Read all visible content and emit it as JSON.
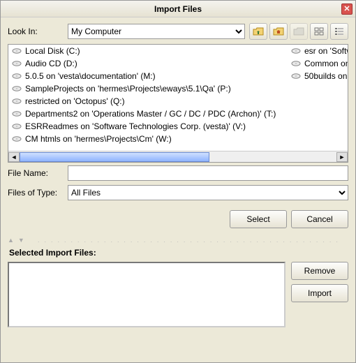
{
  "title": "Import Files",
  "lookin_label": "Look In:",
  "lookin_value": "My Computer",
  "files_col1": [
    "Local Disk (C:)",
    "Audio CD (D:)",
    "5.0.5 on 'vesta\\documentation' (M:)",
    "SampleProjects on 'hermes\\Projects\\eways\\5.1\\Qa' (P:)",
    "restricted on 'Octopus' (Q:)",
    "Departments2 on 'Operations Master / GC / DC / PDC (Archon)' (T:)",
    "ESRReadmes on 'Software Technologies Corp. (vesta)' (V:)",
    "CM htmls on 'hermes\\Projects\\Cm' (W:)"
  ],
  "files_col2": [
    "esr on 'Softw",
    "Common on",
    "50builds on"
  ],
  "filename_label": "File Name:",
  "filename_value": "",
  "filetype_label": "Files of Type:",
  "filetype_value": "All Files",
  "btn_select": "Select",
  "btn_cancel": "Cancel",
  "selected_label": "Selected Import Files:",
  "btn_remove": "Remove",
  "btn_import": "Import"
}
